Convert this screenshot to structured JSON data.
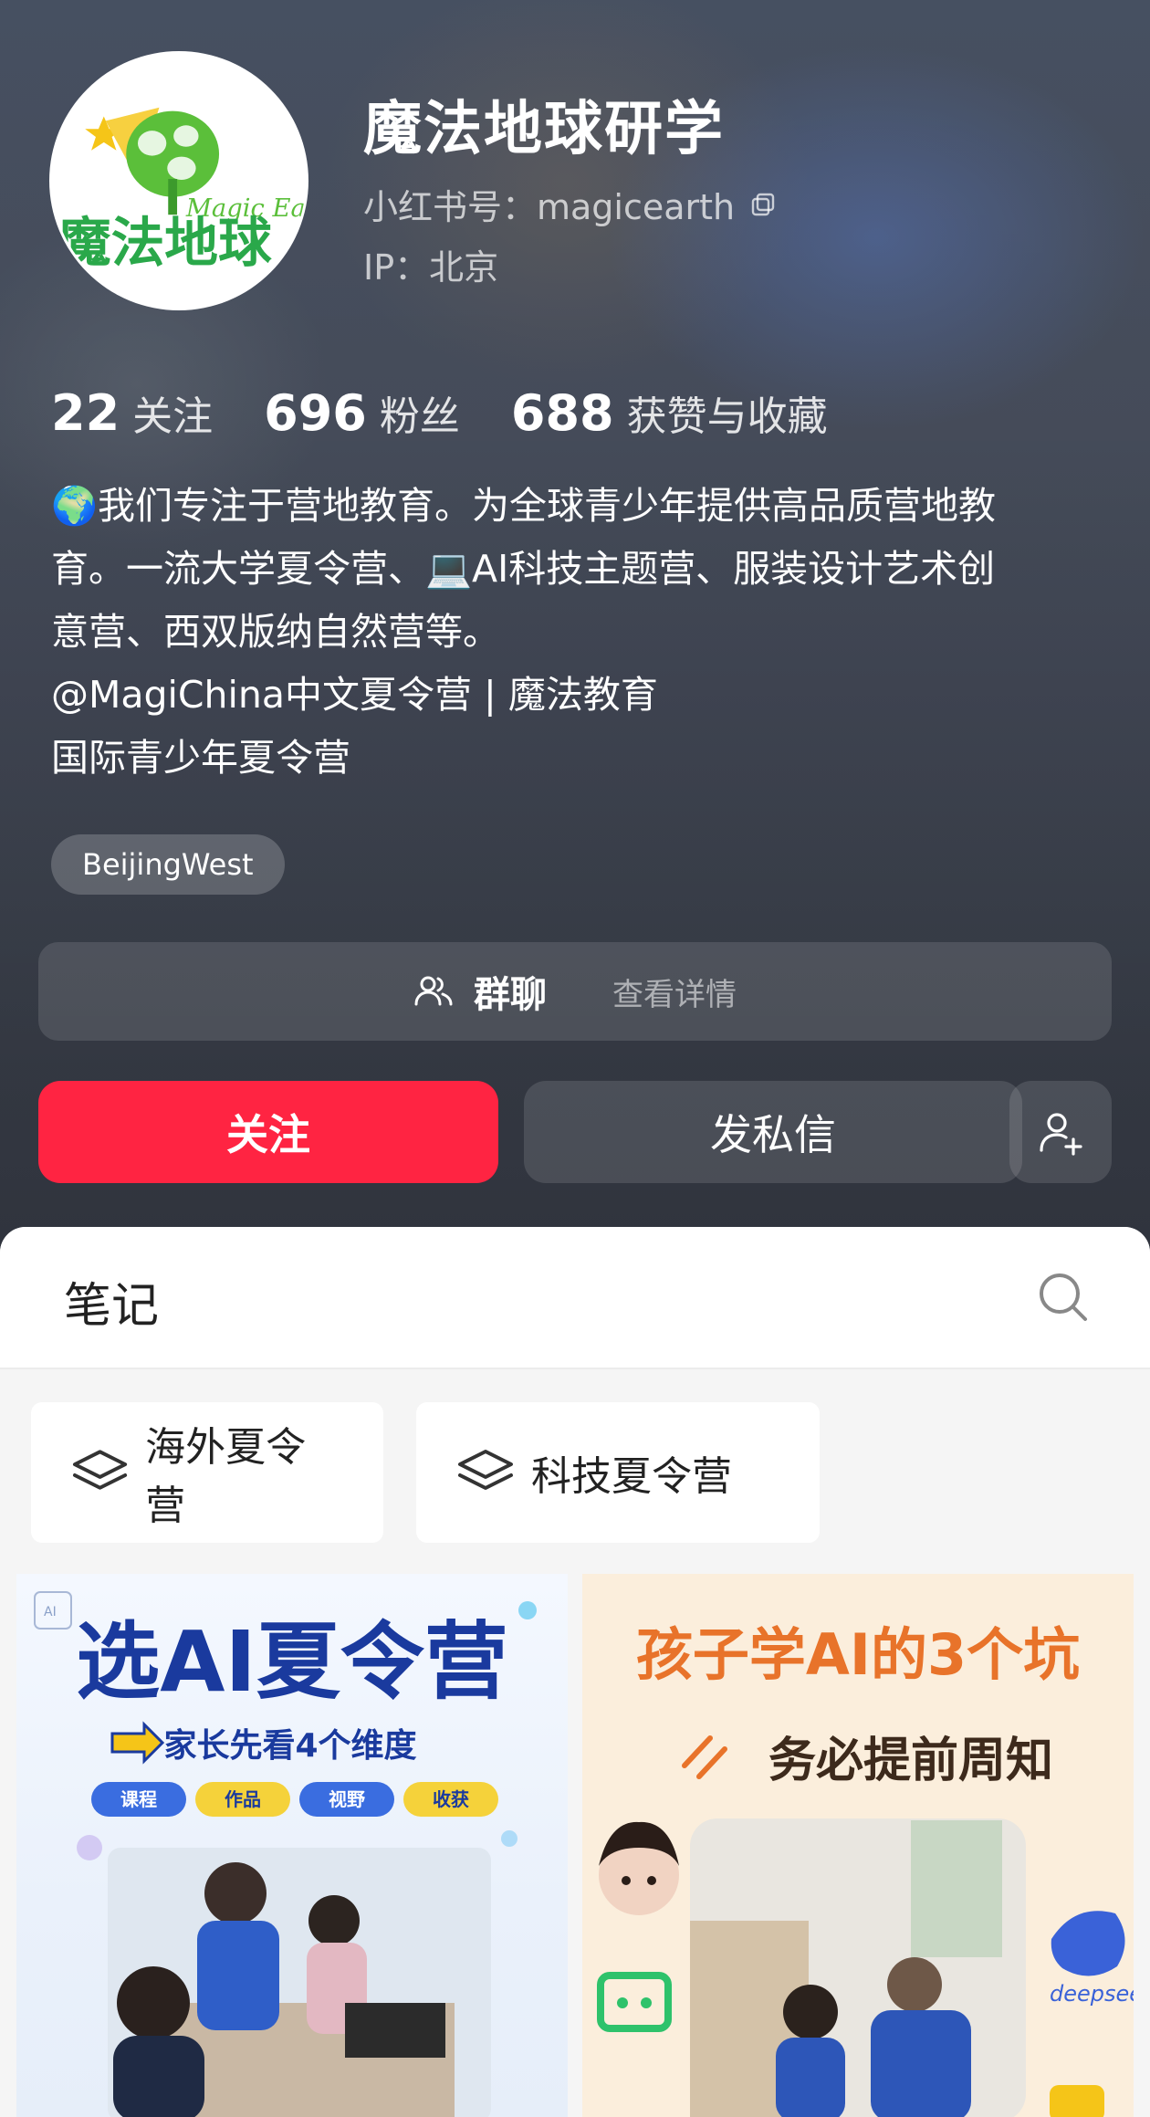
{
  "profile": {
    "name": "魔法地球研学",
    "id_text": "小红书号：magicearth",
    "ip_text": "IP：北京",
    "avatar": {
      "logo_text_en": "Magic Earth",
      "logo_text_cn": "魔法地球"
    }
  },
  "stats": [
    {
      "num": "22",
      "label": "关注"
    },
    {
      "num": "696",
      "label": "粉丝"
    },
    {
      "num": "688",
      "label": "获赞与收藏"
    }
  ],
  "bio": {
    "line1": "🌍我们专注于营地教育。为全球青少年提供高品质营地教",
    "line2": "育。一流大学夏令营、💻AI科技主题营、服装设计艺术创",
    "line3": "意营、西双版纳自然营等。",
    "line4": "@MagiChina中文夏令营 | 魔法教育",
    "line5": "国际青少年夏令营"
  },
  "tag": "BeijingWest",
  "group": {
    "title": "群聊",
    "detail": "查看详情"
  },
  "actions": {
    "follow": "关注",
    "message": "发私信"
  },
  "notes": {
    "title": "笔记",
    "categories": [
      "海外夏令营",
      "科技夏令营"
    ],
    "cards": [
      {
        "headline": "选AI夏令营",
        "sub": "家长先看4个维度",
        "pills": [
          "课程",
          "作品",
          "视野",
          "收获"
        ]
      },
      {
        "headline": "孩子学AI的3个坑",
        "sub": "务必提前周知",
        "brand": "deepseek"
      }
    ]
  },
  "colors": {
    "accent": "#ff2442",
    "header_bg": "#454b58",
    "panel_bg": "#f5f5f5"
  }
}
